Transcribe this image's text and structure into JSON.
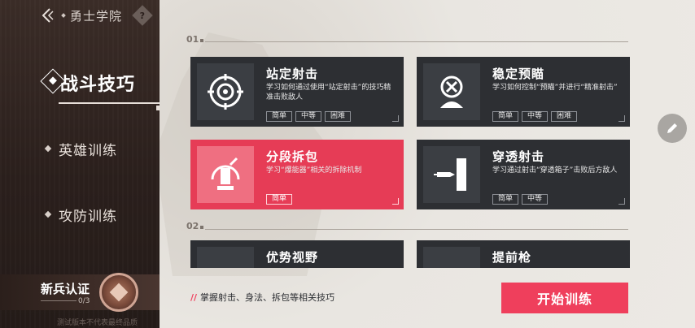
{
  "header": {
    "title": "勇士学院",
    "help": "?"
  },
  "sidebar": {
    "items": [
      {
        "label": "战斗技巧",
        "active": true
      },
      {
        "label": "英雄训练",
        "active": false
      },
      {
        "label": "攻防训练",
        "active": false
      }
    ],
    "recruit": {
      "label": "新兵认证",
      "progress": "0/3"
    },
    "footnote": "测试版本不代表最终品质"
  },
  "sections": [
    {
      "num": "01"
    },
    {
      "num": "02"
    }
  ],
  "cards": [
    {
      "title": "站定射击",
      "desc": "学习如何通过使用“站定射击”的技巧精准击败敌人",
      "tags": [
        "简单",
        "中等",
        "困难"
      ],
      "icon": "crosshair-icon"
    },
    {
      "title": "稳定预瞄",
      "desc": "学习如何控制“预瞄”并进行“精准射击”",
      "tags": [
        "简单",
        "中等",
        "困难"
      ],
      "icon": "target-dummy-icon"
    },
    {
      "title": "分段拆包",
      "desc": "学习“爆能器”相关的拆除机制",
      "tags": [
        "简单"
      ],
      "icon": "bomb-icon"
    },
    {
      "title": "穿透射击",
      "desc": "学习通过射击“穿透箱子”击败后方敌人",
      "tags": [
        "简单",
        "中等"
      ],
      "icon": "bullet-wall-icon"
    },
    {
      "title": "优势视野",
      "desc": "",
      "tags": [],
      "icon": "vision-icon"
    },
    {
      "title": "提前枪",
      "desc": "",
      "tags": [],
      "icon": "gun-icon"
    }
  ],
  "footer": {
    "hint": "掌握射击、身法、拆包等相关技巧",
    "hint_prefix": "//",
    "start_label": "开始训练"
  },
  "colors": {
    "accent": "#ef3f5c",
    "card": "#2d2f33",
    "sidebar": "#2a1f1c"
  }
}
